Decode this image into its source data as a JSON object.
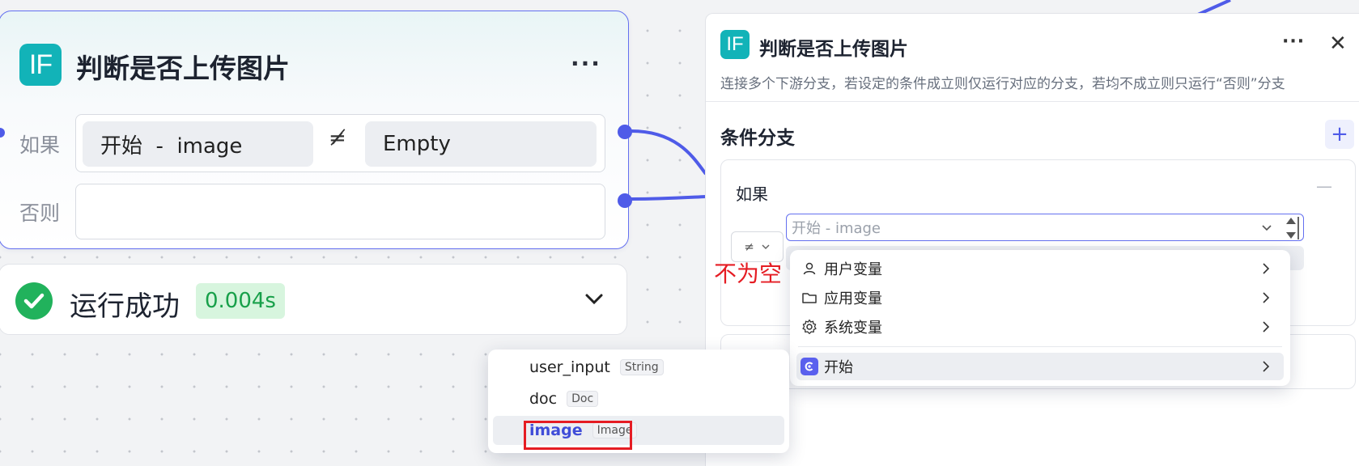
{
  "if_node": {
    "badge": "IF",
    "title": "判断是否上传图片",
    "more": "···",
    "if_label": "如果",
    "else_label": "否则",
    "left_operand": "开始  -  image",
    "operator_symbol": "≠̸",
    "right_operand": "Empty"
  },
  "run_status": {
    "text": "运行成功",
    "duration": "0.004s"
  },
  "panel": {
    "badge": "IF",
    "title": "判断是否上传图片",
    "more": "···",
    "close": "✕",
    "description": "连接多个下游分支，若设定的条件成立则仅运行对应的分支，若均不成立则只运行“否则”分支",
    "section_title": "条件分支",
    "add": "+",
    "case_label": "如果",
    "case_remove": "—",
    "variable_placeholder": "开始 - image"
  },
  "annotation": "不为空",
  "variable_menu": {
    "items": [
      {
        "label": "用户变量",
        "icon": "user-icon"
      },
      {
        "label": "应用变量",
        "icon": "folder-icon"
      },
      {
        "label": "系统变量",
        "icon": "gear-icon"
      }
    ],
    "start_label": "开始"
  },
  "start_vars": [
    {
      "name": "user_input",
      "type": "String"
    },
    {
      "name": "doc",
      "type": "Doc"
    },
    {
      "name": "image",
      "type": "Image",
      "selected": true
    }
  ],
  "colors": {
    "accent": "#4f5be8",
    "teal_badge": "#12b3b8",
    "success": "#21b25c",
    "highlight_red": "#e51c23"
  }
}
